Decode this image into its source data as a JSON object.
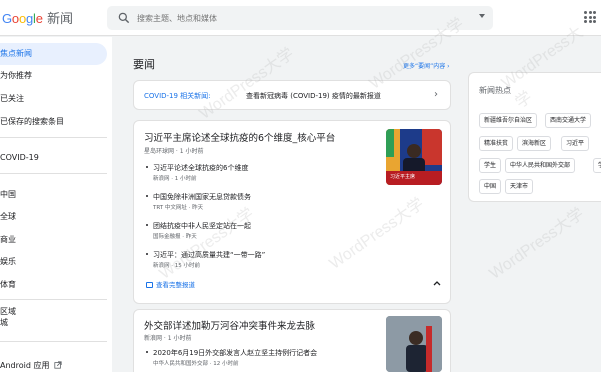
{
  "header": {
    "logo": "Google",
    "logo_suffix": "新闻",
    "search_placeholder": "搜索主题、地点和媒体"
  },
  "sidebar": {
    "items": [
      {
        "label": "焦点新闻"
      },
      {
        "label": "为你推荐"
      },
      {
        "label": "已关注"
      },
      {
        "label": "已保存的搜索条目"
      },
      {
        "label": "COVID-19"
      },
      {
        "label": "中国"
      },
      {
        "label": "全球"
      },
      {
        "label": "商业"
      },
      {
        "label": "娱乐"
      },
      {
        "label": "体育"
      },
      {
        "label": "区域"
      },
      {
        "label": "城"
      },
      {
        "label": "Android 应用"
      }
    ]
  },
  "main": {
    "section_title": "要闻",
    "more_link": "更多“要闻”内容",
    "covid": {
      "tag": "COVID-19 相关新闻:",
      "message": "查看新冠病毒 (COVID-19) 疫情的最新报道"
    },
    "story1": {
      "headline": "习近平主席论述全球抗疫的6个维度_核心平台",
      "source": "星岛环球网",
      "time": "1 小时前",
      "thumb_caption": "习近平主席",
      "related": [
        {
          "title": "习近平论述全球抗疫的6个维度",
          "source": "新浪网",
          "time": "1 小时前"
        },
        {
          "title": "中国免除非洲国家无息贷款债务",
          "source": "TRT 中文网址",
          "time": "昨天"
        },
        {
          "title": "团结抗疫中非人民坚定站在一起",
          "source": "国际金融报",
          "time": "昨天"
        },
        {
          "title": "习近平：通过高质量共建“一带一路”",
          "source": "新浪网",
          "time": "15 小时前"
        }
      ],
      "full_coverage": "查看完整报道"
    },
    "story2": {
      "headline": "外交部详述加勒万河谷冲突事件来龙去脉",
      "source": "新浪网",
      "time": "1 小时前",
      "related": [
        {
          "title": "2020年6月19日外交部发言人赵立坚主持例行记者会",
          "source": "中华人民共和国外交部",
          "time": "12 小时前"
        }
      ]
    }
  },
  "trending": {
    "title": "新闻热点",
    "chips": [
      "新疆维吾尔自治区",
      "西南交通大学",
      "精准扶贫",
      "滨海新区",
      "习近平",
      "学生",
      "中华人民共和国外交部",
      "学",
      "中国",
      "天津市"
    ]
  },
  "watermark": "WordPress大学"
}
